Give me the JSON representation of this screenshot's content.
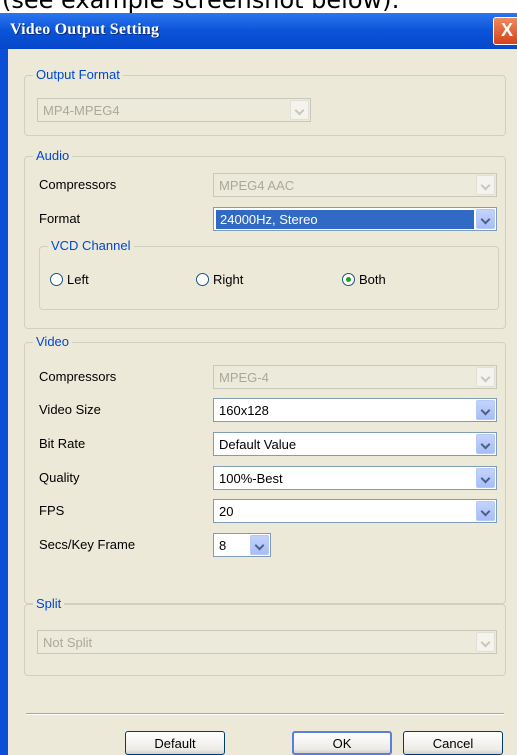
{
  "caption": "(see example screenshot below):",
  "window": {
    "title": "Video Output Setting",
    "close_symbol": "X"
  },
  "output_format": {
    "legend": "Output Format",
    "value": "MP4-MPEG4"
  },
  "audio": {
    "legend": "Audio",
    "compressors_label": "Compressors",
    "compressors_value": "MPEG4 AAC",
    "format_label": "Format",
    "format_value": "24000Hz, Stereo",
    "vcd_channel": {
      "legend": "VCD Channel",
      "options": [
        {
          "label": "Left",
          "checked": false
        },
        {
          "label": "Right",
          "checked": false
        },
        {
          "label": "Both",
          "checked": true
        }
      ]
    }
  },
  "video": {
    "legend": "Video",
    "compressors_label": "Compressors",
    "compressors_value": "MPEG-4",
    "video_size_label": "Video Size",
    "video_size_value": "160x128",
    "bit_rate_label": "Bit Rate",
    "bit_rate_value": "Default Value",
    "quality_label": "Quality",
    "quality_value": "100%-Best",
    "fps_label": "FPS",
    "fps_value": "20",
    "secs_key_frame_label": "Secs/Key Frame",
    "secs_key_frame_value": "8"
  },
  "split": {
    "legend": "Split",
    "value": "Not Split"
  },
  "buttons": {
    "default_label": "Default",
    "ok_label": "OK",
    "cancel_label": "Cancel"
  },
  "colors": {
    "title_bar": "#0a53d8",
    "dialog_background": "#ece9d8",
    "legend_text": "#0046d5",
    "selection": "#316ac5",
    "close_button": "#d4421a"
  }
}
